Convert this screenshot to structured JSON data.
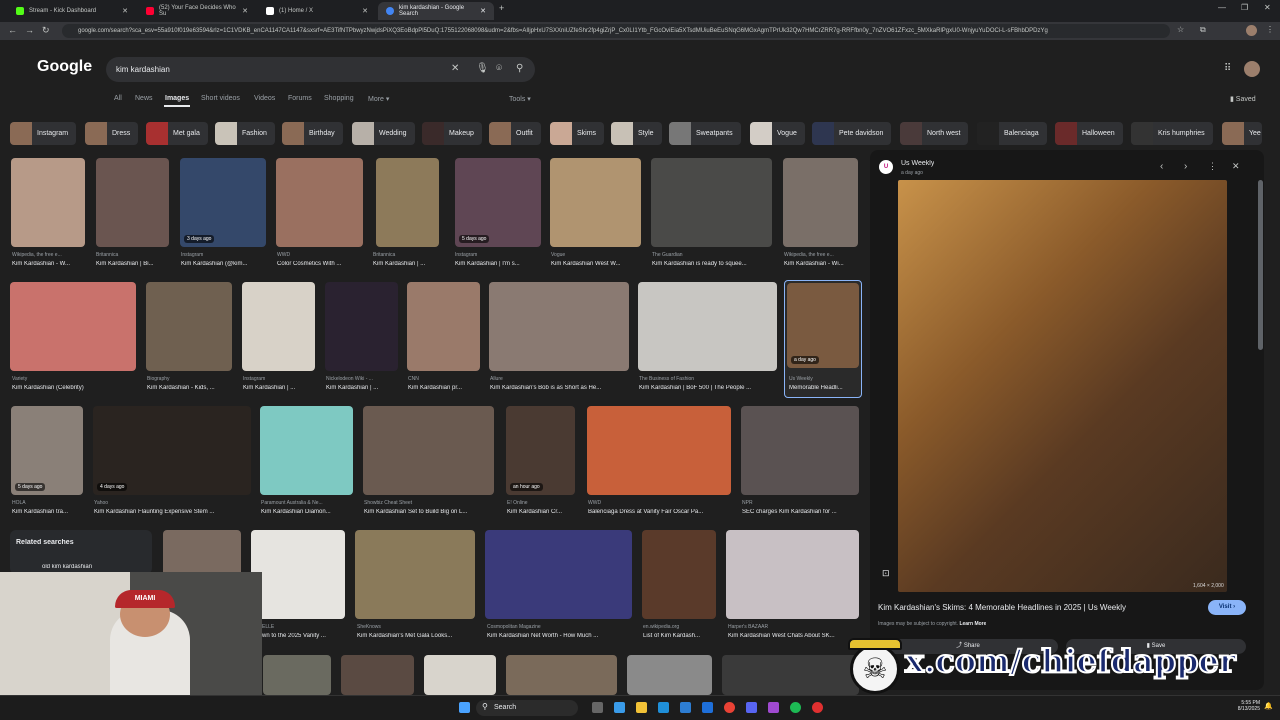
{
  "browser": {
    "tabs": [
      {
        "title": "Stream - Kick Dashboard",
        "color": "#53fc18"
      },
      {
        "title": "(52) Your Face Decides Who Su",
        "color": "#ff0033"
      },
      {
        "title": "(1) Home / X",
        "color": "#ffffff"
      },
      {
        "title": "kim kardashian - Google Search",
        "color": "#4285f4"
      }
    ],
    "new_tab": "+",
    "url": "google.com/search?sca_esv=55a910f019e63594&rlz=1C1VDKB_enCA1147CA1147&sxsrf=AE3TifNTPbwyzNwjdsPiXQ3EoBdpPl5DuQ:1755122068098&udm=2&fbs=AIljpHxU7SXXniUZfeShr2fp4giZrjP_Cx0LI1Ytb_FGcOviEia5XTsdMUiuBeEuSNqG6MGxAgmTPrUk32Qw7HMCrZRR7g-RRFfbn0y_7nZVO61ZFxzc_5MXkaRlPgxU0-WnjyuYuDOCi-L-sFBhbDPDzYg"
  },
  "google": {
    "logo": "Google",
    "query": "kim kardashian",
    "nav": [
      "All",
      "News",
      "Images",
      "Short videos",
      "Videos",
      "Forums",
      "Shopping",
      "More",
      "Tools"
    ],
    "saved": "Saved",
    "chips": [
      "Instagram",
      "Dress",
      "Met gala",
      "Fashion",
      "Birthday",
      "Wedding",
      "Makeup",
      "Outfit",
      "Skims",
      "Style",
      "Sweatpants",
      "Vogue",
      "Pete davidson",
      "North west",
      "Balenciaga",
      "Halloween",
      "Kris humphries",
      "Yee"
    ],
    "rows": [
      [
        {
          "source": "Wikipedia, the free e...",
          "caption": "Kim Kardashian - W..."
        },
        {
          "source": "Britannica",
          "caption": "Kim Kardashian | Bi..."
        },
        {
          "source": "Instagram",
          "caption": "Kim Kardashian (@kim...",
          "badge": "3 days ago"
        },
        {
          "source": "WWD",
          "caption": "Color Cosmetics With ..."
        },
        {
          "source": "Britannica",
          "caption": "Kim Kardashian | ..."
        },
        {
          "source": "Instagram",
          "caption": "Kim Kardashian | I'm s...",
          "badge": "5 days ago"
        },
        {
          "source": "Vogue",
          "caption": "Kim Kardashian West W..."
        },
        {
          "source": "The Guardian",
          "caption": "Kim Kardashian is ready to squee..."
        },
        {
          "source": "Wikipedia, the free e...",
          "caption": "Kim Kardashian - Wi..."
        }
      ],
      [
        {
          "source": "Variety",
          "caption": "Kim Kardashian (Celebrity)"
        },
        {
          "source": "Biography",
          "caption": "Kim Kardashian - Kids, ..."
        },
        {
          "source": "Instagram",
          "caption": "Kim Kardashian | ..."
        },
        {
          "source": "Nickelodeon Wiki - ...",
          "caption": "Kim Kardashian | ..."
        },
        {
          "source": "CNN",
          "caption": "Kim Kardashian pr..."
        },
        {
          "source": "Allure",
          "caption": "Kim Kardashian's Bob is as Short as He..."
        },
        {
          "source": "The Business of Fashion",
          "caption": "Kim Kardashian | BoF 500 | The People ..."
        },
        {
          "source": "Us Weekly",
          "caption": "Memorable Headli...",
          "badge": "a day ago"
        }
      ],
      [
        {
          "source": "HOLA",
          "caption": "Kim Kardashian tra...",
          "badge": "5 days ago"
        },
        {
          "source": "Yahoo",
          "caption": "Kim Kardashian Flaunting Expensive Stem ...",
          "badge": "4 days ago"
        },
        {
          "source": "Paramount Australia & Ne...",
          "caption": "Kim Kardashian Diamon..."
        },
        {
          "source": "Showbiz Cheat Sheet",
          "caption": "Kim Kardashian Set to Build Big on L..."
        },
        {
          "source": "E! Online",
          "caption": "Kim Kardashian Cr...",
          "badge": "an hour ago"
        },
        {
          "source": "WWD",
          "caption": "Balenciaga Dress at Vanity Fair Oscar Pa..."
        },
        {
          "source": "NPR",
          "caption": "SEC charges Kim Kardashian for ..."
        }
      ],
      [
        {
          "source": "ELLE",
          "caption": "wn to the 2025 Vanity ..."
        },
        {
          "source": "SheKnows",
          "caption": "Kim Kardashian's Met Gala Looks..."
        },
        {
          "source": "Cosmopolitan Magazine",
          "caption": "Kim Kardashian Net Worth - How Much ..."
        },
        {
          "source": "en.wikipedia.org",
          "caption": "List of Kim Kardash..."
        },
        {
          "source": "Harper's BAZAAR",
          "caption": "Kim Kardashian West Chats About SK..."
        }
      ]
    ],
    "related_title": "Related searches",
    "related_item": "old kim kardashian"
  },
  "panel": {
    "source": "Us Weekly",
    "time": "a day ago",
    "dimensions": "1,604 × 2,000",
    "title": "Kim Kardashian's Skims: 4 Memorable Headlines in 2025 | Us Weekly",
    "copyright": "Images may be subject to copyright.",
    "learn_more": "Learn More",
    "visit": "Visit",
    "share": "Share",
    "save": "Save"
  },
  "overlay": {
    "text": "x.com/chiefdapper"
  },
  "taskbar": {
    "search": "Search",
    "time": "5:55 PM",
    "date": "8/13/2025"
  },
  "webcam": {
    "cap_text": "MIAMI"
  },
  "colors": {
    "accent": "#8ab4f8",
    "page_bg": "#1f1f1f",
    "panel_bg": "#171717"
  }
}
